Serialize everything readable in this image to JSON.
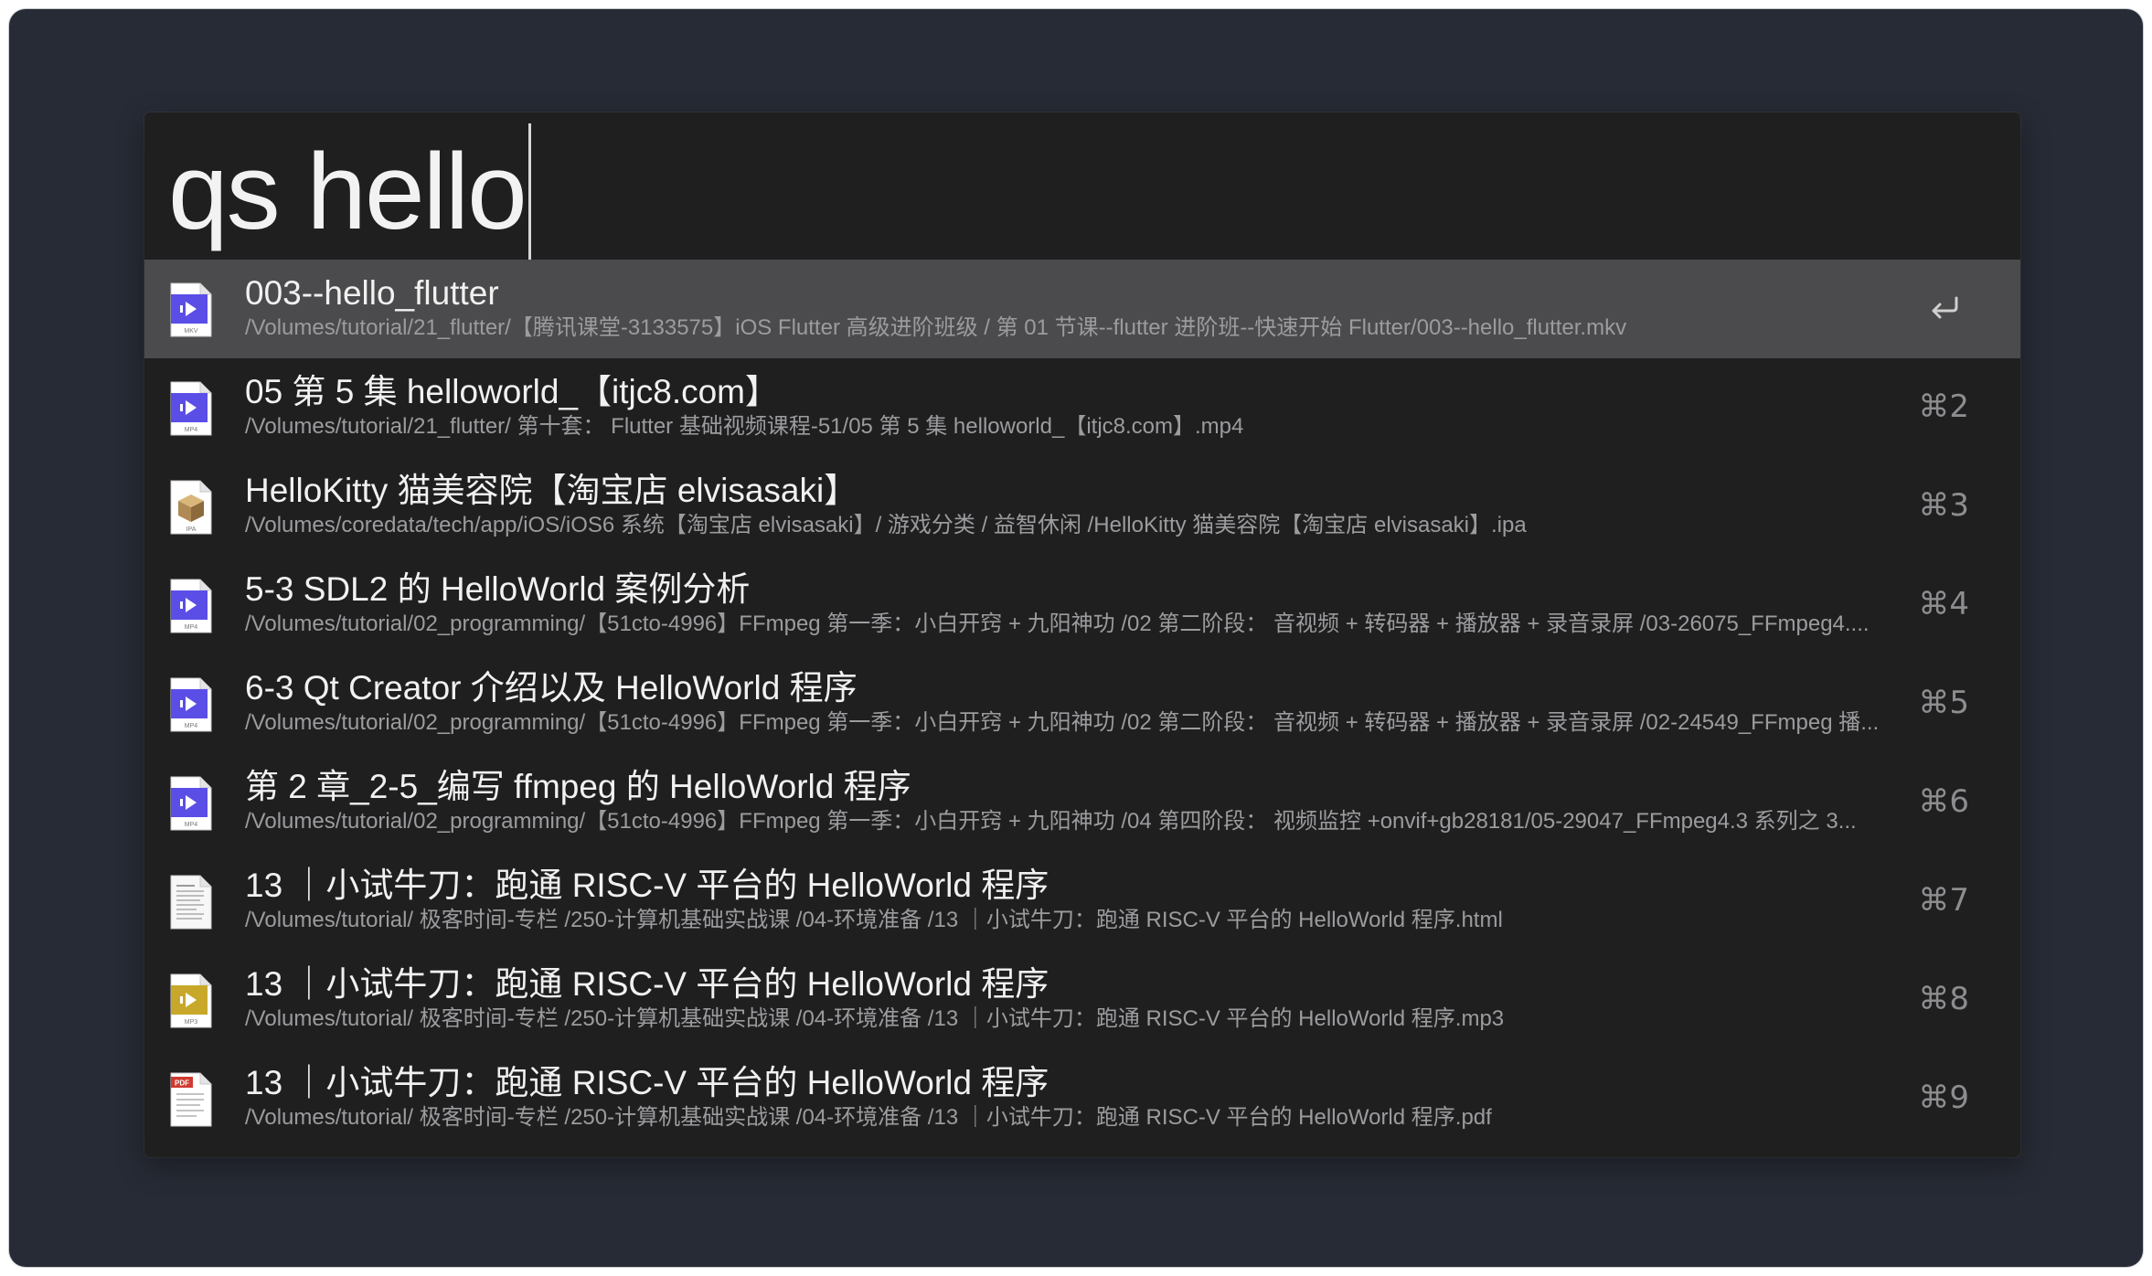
{
  "query": {
    "text": "qs hello"
  },
  "results": [
    {
      "title": "003--hello_flutter",
      "path": "/Volumes/tutorial/21_flutter/【腾讯课堂-3133575】iOS Flutter 高级进阶班级 / 第 01 节课--flutter 进阶班--快速开始 Flutter/003--hello_flutter.mkv",
      "icon": "video-file-icon",
      "icon_label": "MKV",
      "icon_color": "#5b4ee6",
      "shortcut": "↩"
    },
    {
      "title": "05 第 5 集 helloworld_【itjc8.com】",
      "path": "/Volumes/tutorial/21_flutter/ 第十套： Flutter 基础视频课程-51/05 第 5 集 helloworld_【itjc8.com】.mp4",
      "icon": "video-file-icon",
      "icon_label": "MP4",
      "icon_color": "#5b4ee6",
      "shortcut": "⌘2"
    },
    {
      "title": "HelloKitty 猫美容院【淘宝店 elvisasaki】",
      "path": "/Volumes/coredata/tech/app/iOS/iOS6 系统【淘宝店 elvisasaki】/ 游戏分类 / 益智休闲 /HelloKitty 猫美容院【淘宝店 elvisasaki】.ipa",
      "icon": "ipa-package-icon",
      "icon_label": "IPA",
      "icon_color": "#b08a55",
      "shortcut": "⌘3"
    },
    {
      "title": "5-3 SDL2 的 HelloWorld 案例分析",
      "path": "/Volumes/tutorial/02_programming/【51cto-4996】FFmpeg 第一季：小白开窍 + 九阳神功 /02 第二阶段： 音视频 + 转码器 + 播放器 + 录音录屏 /03-26075_FFmpeg4....",
      "icon": "video-file-icon",
      "icon_label": "MP4",
      "icon_color": "#5b4ee6",
      "shortcut": "⌘4"
    },
    {
      "title": "6-3 Qt Creator 介绍以及 HelloWorld 程序",
      "path": "/Volumes/tutorial/02_programming/【51cto-4996】FFmpeg 第一季：小白开窍 + 九阳神功 /02 第二阶段： 音视频 + 转码器 + 播放器 + 录音录屏 /02-24549_FFmpeg 播...",
      "icon": "video-file-icon",
      "icon_label": "MP4",
      "icon_color": "#5b4ee6",
      "shortcut": "⌘5"
    },
    {
      "title": "第 2 章_2-5_编写 ffmpeg 的 HelloWorld 程序",
      "path": "/Volumes/tutorial/02_programming/【51cto-4996】FFmpeg 第一季：小白开窍 + 九阳神功 /04 第四阶段： 视频监控 +onvif+gb28181/05-29047_FFmpeg4.3 系列之 3...",
      "icon": "video-file-icon",
      "icon_label": "MP4",
      "icon_color": "#5b4ee6",
      "shortcut": "⌘6"
    },
    {
      "title": "13 ｜小试牛刀：跑通 RISC-V 平台的 HelloWorld 程序",
      "path": "/Volumes/tutorial/ 极客时间-专栏 /250-计算机基础实战课 /04-环境准备 /13 ｜小试牛刀：跑通 RISC-V 平台的 HelloWorld 程序.html",
      "icon": "html-document-icon",
      "icon_label": "",
      "icon_color": "#d0d0d0",
      "shortcut": "⌘7"
    },
    {
      "title": "13 ｜小试牛刀：跑通 RISC-V 平台的 HelloWorld 程序",
      "path": "/Volumes/tutorial/ 极客时间-专栏 /250-计算机基础实战课 /04-环境准备 /13 ｜小试牛刀：跑通 RISC-V 平台的 HelloWorld 程序.mp3",
      "icon": "audio-file-icon",
      "icon_label": "MP3",
      "icon_color": "#c8a82a",
      "shortcut": "⌘8"
    },
    {
      "title": "13 ｜小试牛刀：跑通 RISC-V 平台的 HelloWorld 程序",
      "path": "/Volumes/tutorial/ 极客时间-专栏 /250-计算机基础实战课 /04-环境准备 /13 ｜小试牛刀：跑通 RISC-V 平台的 HelloWorld 程序.pdf",
      "icon": "pdf-document-icon",
      "icon_label": "PDF",
      "icon_color": "#d03a2f",
      "shortcut": "⌘9"
    }
  ]
}
